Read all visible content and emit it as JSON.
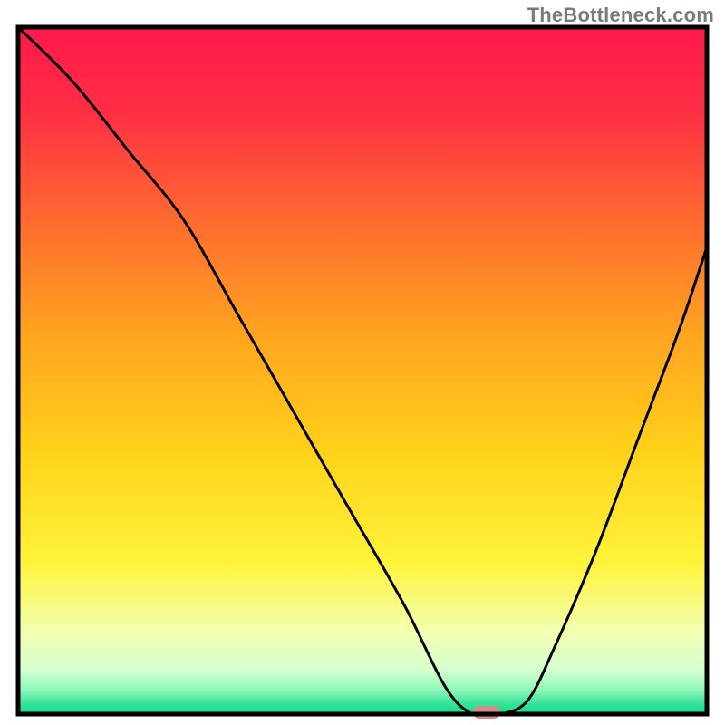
{
  "watermark": "TheBottleneck.com",
  "chart_data": {
    "type": "line",
    "title": "",
    "xlabel": "",
    "ylabel": "",
    "xlim": [
      0,
      100
    ],
    "ylim": [
      0,
      100
    ],
    "grid": false,
    "legend": false,
    "series": [
      {
        "name": "bottleneck-curve",
        "x": [
          0,
          8,
          16,
          24,
          32,
          40,
          48,
          56,
          62,
          66,
          70,
          74,
          78,
          84,
          90,
          96,
          100
        ],
        "y": [
          100,
          92,
          82,
          72,
          58,
          44,
          30,
          16,
          4,
          0,
          0,
          2,
          10,
          24,
          40,
          56,
          68
        ]
      }
    ],
    "marker": {
      "name": "optimal-marker",
      "x": 68,
      "y": 0,
      "color": "#d98888"
    },
    "gradient_stops": [
      {
        "offset": 0.0,
        "color": "#ff1a4b"
      },
      {
        "offset": 0.12,
        "color": "#ff2d44"
      },
      {
        "offset": 0.28,
        "color": "#ff6a2f"
      },
      {
        "offset": 0.45,
        "color": "#ffa51f"
      },
      {
        "offset": 0.62,
        "color": "#ffd21a"
      },
      {
        "offset": 0.78,
        "color": "#fff43a"
      },
      {
        "offset": 0.88,
        "color": "#f3ffb0"
      },
      {
        "offset": 0.935,
        "color": "#d6ffd0"
      },
      {
        "offset": 0.965,
        "color": "#8df7b8"
      },
      {
        "offset": 0.985,
        "color": "#34e49a"
      },
      {
        "offset": 1.0,
        "color": "#17d985"
      }
    ],
    "frame_color": "#000000",
    "line_color": "#000000",
    "line_width": 3
  }
}
